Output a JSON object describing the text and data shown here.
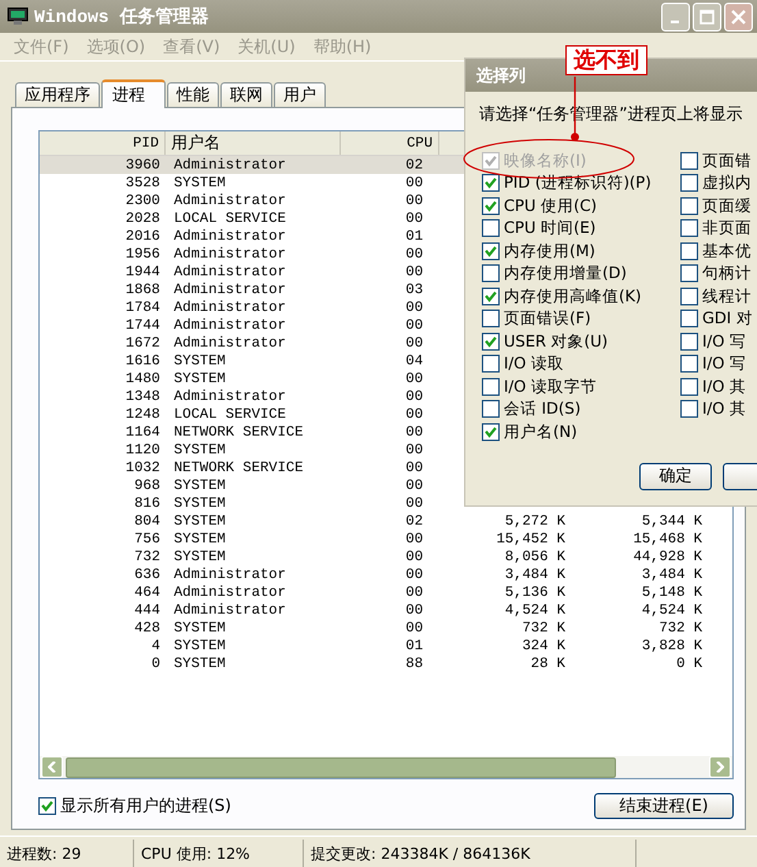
{
  "window": {
    "title": "Windows 任务管理器"
  },
  "menu": [
    "文件(F)",
    "选项(O)",
    "查看(V)",
    "关机(U)",
    "帮助(H)"
  ],
  "tabs": [
    {
      "label": "应用程序",
      "selected": false
    },
    {
      "label": "进程",
      "selected": true
    },
    {
      "label": "性能",
      "selected": false
    },
    {
      "label": "联网",
      "selected": false
    },
    {
      "label": "用户",
      "selected": false
    }
  ],
  "table": {
    "columns": [
      "PID",
      "用户名",
      "CPU"
    ],
    "rows": [
      {
        "pid": "3960",
        "user": "Administrator",
        "cpu": "02",
        "selected": true
      },
      {
        "pid": "3528",
        "user": "SYSTEM",
        "cpu": "00",
        "selected": false
      },
      {
        "pid": "2300",
        "user": "Administrator",
        "cpu": "00",
        "selected": false
      },
      {
        "pid": "2028",
        "user": "LOCAL SERVICE",
        "cpu": "00",
        "selected": false
      },
      {
        "pid": "2016",
        "user": "Administrator",
        "cpu": "01",
        "selected": false
      },
      {
        "pid": "1956",
        "user": "Administrator",
        "cpu": "00",
        "selected": false
      },
      {
        "pid": "1944",
        "user": "Administrator",
        "cpu": "00",
        "selected": false
      },
      {
        "pid": "1868",
        "user": "Administrator",
        "cpu": "03",
        "selected": false
      },
      {
        "pid": "1784",
        "user": "Administrator",
        "cpu": "00",
        "selected": false
      },
      {
        "pid": "1744",
        "user": "Administrator",
        "cpu": "00",
        "selected": false
      },
      {
        "pid": "1672",
        "user": "Administrator",
        "cpu": "00",
        "selected": false
      },
      {
        "pid": "1616",
        "user": "SYSTEM",
        "cpu": "04",
        "selected": false
      },
      {
        "pid": "1480",
        "user": "SYSTEM",
        "cpu": "00",
        "selected": false
      },
      {
        "pid": "1348",
        "user": "Administrator",
        "cpu": "00",
        "selected": false
      },
      {
        "pid": "1248",
        "user": "LOCAL SERVICE",
        "cpu": "00",
        "selected": false
      },
      {
        "pid": "1164",
        "user": "NETWORK SERVICE",
        "cpu": "00",
        "selected": false
      },
      {
        "pid": "1120",
        "user": "SYSTEM",
        "cpu": "00",
        "selected": false
      },
      {
        "pid": "1032",
        "user": "NETWORK SERVICE",
        "cpu": "00",
        "selected": false
      },
      {
        "pid": "968",
        "user": "SYSTEM",
        "cpu": "00",
        "selected": false
      },
      {
        "pid": "816",
        "user": "SYSTEM",
        "cpu": "00",
        "selected": false
      },
      {
        "pid": "804",
        "user": "SYSTEM",
        "cpu": "02",
        "column_4": "5,272 K",
        "column_5": "5,344 K",
        "selected": false
      },
      {
        "pid": "756",
        "user": "SYSTEM",
        "cpu": "00",
        "column_4": "15,452 K",
        "column_5": "15,468 K",
        "selected": false
      },
      {
        "pid": "732",
        "user": "SYSTEM",
        "cpu": "00",
        "column_4": "8,056 K",
        "column_5": "44,928 K",
        "selected": false
      },
      {
        "pid": "636",
        "user": "Administrator",
        "cpu": "00",
        "column_4": "3,484 K",
        "column_5": "3,484 K",
        "selected": false
      },
      {
        "pid": "464",
        "user": "Administrator",
        "cpu": "00",
        "column_4": "5,136 K",
        "column_5": "5,148 K",
        "selected": false
      },
      {
        "pid": "444",
        "user": "Administrator",
        "cpu": "00",
        "column_4": "4,524 K",
        "column_5": "4,524 K",
        "selected": false
      },
      {
        "pid": "428",
        "user": "SYSTEM",
        "cpu": "00",
        "column_4": "732 K",
        "column_5": "732 K",
        "selected": false
      },
      {
        "pid": "4",
        "user": "SYSTEM",
        "cpu": "01",
        "column_4": "324 K",
        "column_5": "3,828 K",
        "selected": false
      },
      {
        "pid": "0",
        "user": "SYSTEM",
        "cpu": "88",
        "column_4": "28 K",
        "column_5": "0 K",
        "selected": false
      }
    ]
  },
  "show_all_users": {
    "label": "显示所有用户的进程(S)",
    "checked": true
  },
  "end_process_button": "结束进程(E)",
  "status_bar": [
    "进程数: 29",
    "CPU 使用: 12%",
    "提交更改: 243384K / 864136K"
  ],
  "dialog": {
    "title": "选择列",
    "description": "请选择“任务管理器”进程页上将显示",
    "left_items": [
      {
        "label": "映像名称(I)",
        "checked": true,
        "disabled": true
      },
      {
        "label": "PID (进程标识符)(P)",
        "checked": true,
        "disabled": false
      },
      {
        "label": "CPU 使用(C)",
        "checked": true,
        "disabled": false
      },
      {
        "label": "CPU 时间(E)",
        "checked": false,
        "disabled": false
      },
      {
        "label": "内存使用(M)",
        "checked": true,
        "disabled": false
      },
      {
        "label": "内存使用增量(D)",
        "checked": false,
        "disabled": false
      },
      {
        "label": "内存使用高峰值(K)",
        "checked": true,
        "disabled": false
      },
      {
        "label": "页面错误(F)",
        "checked": false,
        "disabled": false
      },
      {
        "label": "USER 对象(U)",
        "checked": true,
        "disabled": false
      },
      {
        "label": "I/O 读取",
        "checked": false,
        "disabled": false
      },
      {
        "label": "I/O 读取字节",
        "checked": false,
        "disabled": false
      },
      {
        "label": "会话 ID(S)",
        "checked": false,
        "disabled": false
      },
      {
        "label": "用户名(N)",
        "checked": true,
        "disabled": false
      }
    ],
    "right_items": [
      {
        "label": "页面错",
        "checked": false,
        "disabled": false
      },
      {
        "label": "虚拟内",
        "checked": false,
        "disabled": false
      },
      {
        "label": "页面缓",
        "checked": false,
        "disabled": false
      },
      {
        "label": "非页面",
        "checked": false,
        "disabled": false
      },
      {
        "label": "基本优",
        "checked": false,
        "disabled": false
      },
      {
        "label": "句柄计",
        "checked": false,
        "disabled": false
      },
      {
        "label": "线程计",
        "checked": false,
        "disabled": false
      },
      {
        "label": "GDI 对",
        "checked": false,
        "disabled": false
      },
      {
        "label": "I/O 写",
        "checked": false,
        "disabled": false
      },
      {
        "label": "I/O 写",
        "checked": false,
        "disabled": false
      },
      {
        "label": "I/O 其",
        "checked": false,
        "disabled": false
      },
      {
        "label": "I/O 其",
        "checked": false,
        "disabled": false
      }
    ],
    "ok_button": "确定"
  },
  "annotation": {
    "label": "选不到"
  }
}
